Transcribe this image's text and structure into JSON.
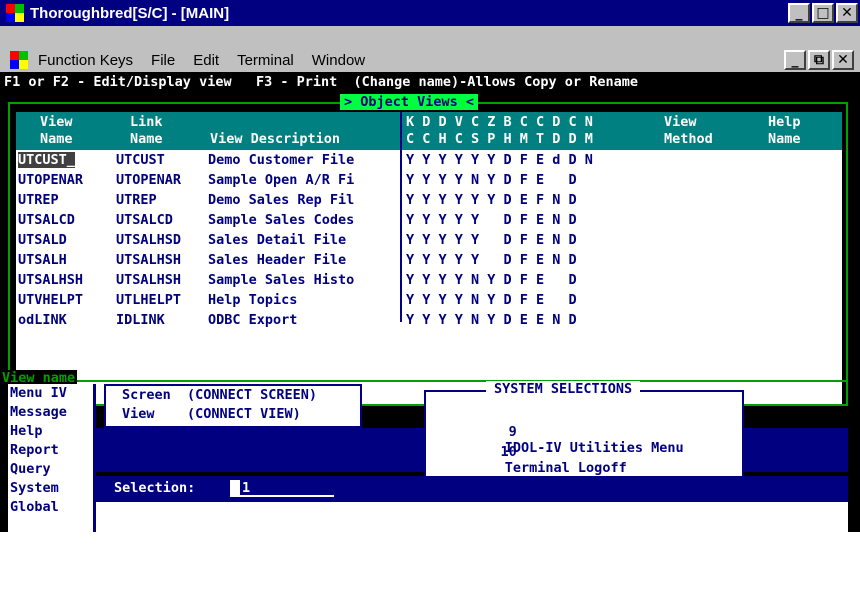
{
  "window": {
    "title": "Thoroughbred[S/C] - [MAIN]",
    "min_label": "_",
    "max_label": "□",
    "close_label": "✕",
    "mdi_min_label": "_",
    "mdi_restore_label": "⧉",
    "mdi_close_label": "✕"
  },
  "menubar": {
    "items": [
      "Function Keys",
      "File",
      "Edit",
      "Terminal",
      "Window"
    ]
  },
  "terminal": {
    "fkeys": "F1 or F2 - Edit/Display view   F3 - Print  (Change name)-Allows Copy or Rename",
    "panel_title": "> Object Views <",
    "headers": {
      "view": "View\nName",
      "link": "Link\nName",
      "desc": "View Description",
      "flags_top": "K D D V C Z B C C D C N",
      "flags_bottom": "C C H C S P H M T D D M",
      "method": "View\nMethod",
      "help": "Help\nName"
    },
    "rows": [
      {
        "view": "UTCUST_",
        "link": "UTCUST",
        "desc": "Demo Customer File",
        "flags": "Y Y Y Y Y Y D F E d D N"
      },
      {
        "view": "UTOPENAR",
        "link": "UTOPENAR",
        "desc": "Sample Open A/R Fi",
        "flags": "Y Y Y Y N Y D F E   D"
      },
      {
        "view": "UTREP",
        "link": "UTREP",
        "desc": "Demo Sales Rep Fil",
        "flags": "Y Y Y Y Y Y D E F N D"
      },
      {
        "view": "UTSALCD",
        "link": "UTSALCD",
        "desc": "Sample Sales Codes",
        "flags": "Y Y Y Y Y   D F E N D"
      },
      {
        "view": "UTSALD",
        "link": "UTSALHSD",
        "desc": "Sales Detail File",
        "flags": "Y Y Y Y Y   D F E N D"
      },
      {
        "view": "UTSALH",
        "link": "UTSALHSH",
        "desc": "Sales Header File",
        "flags": "Y Y Y Y Y   D F E N D"
      },
      {
        "view": "UTSALHSH",
        "link": "UTSALHSH",
        "desc": "Sample Sales Histo",
        "flags": "Y Y Y Y N Y D F E   D"
      },
      {
        "view": "UTVHELPT",
        "link": "UTLHELPT",
        "desc": "Help Topics",
        "flags": "Y Y Y Y N Y D F E   D"
      },
      {
        "view": "odLINK",
        "link": "IDLINK",
        "desc": "ODBC Export",
        "flags": "Y Y Y Y N Y D E E N D"
      }
    ],
    "view_name_label": "View name",
    "left_menu": [
      "Menu IV",
      "Message",
      "Help",
      "Report",
      "Query",
      "System",
      "Global"
    ],
    "connect": [
      "Screen  (CONNECT SCREEN)",
      "View    (CONNECT VIEW)"
    ],
    "system_selections": {
      "title": "SYSTEM SELECTIONS",
      "items": [
        {
          "num": "9",
          "label": "IDOL-IV Utilities Menu"
        },
        {
          "num": "10",
          "label": "Terminal Logoff"
        }
      ]
    },
    "selection_label": "Selection:",
    "selection_value": "1"
  },
  "colors": {
    "title_bar": "#000080",
    "terminal_bg": "#000000",
    "header_teal": "#008080",
    "frame_green": "#00a000",
    "text_navy": "#000080"
  }
}
